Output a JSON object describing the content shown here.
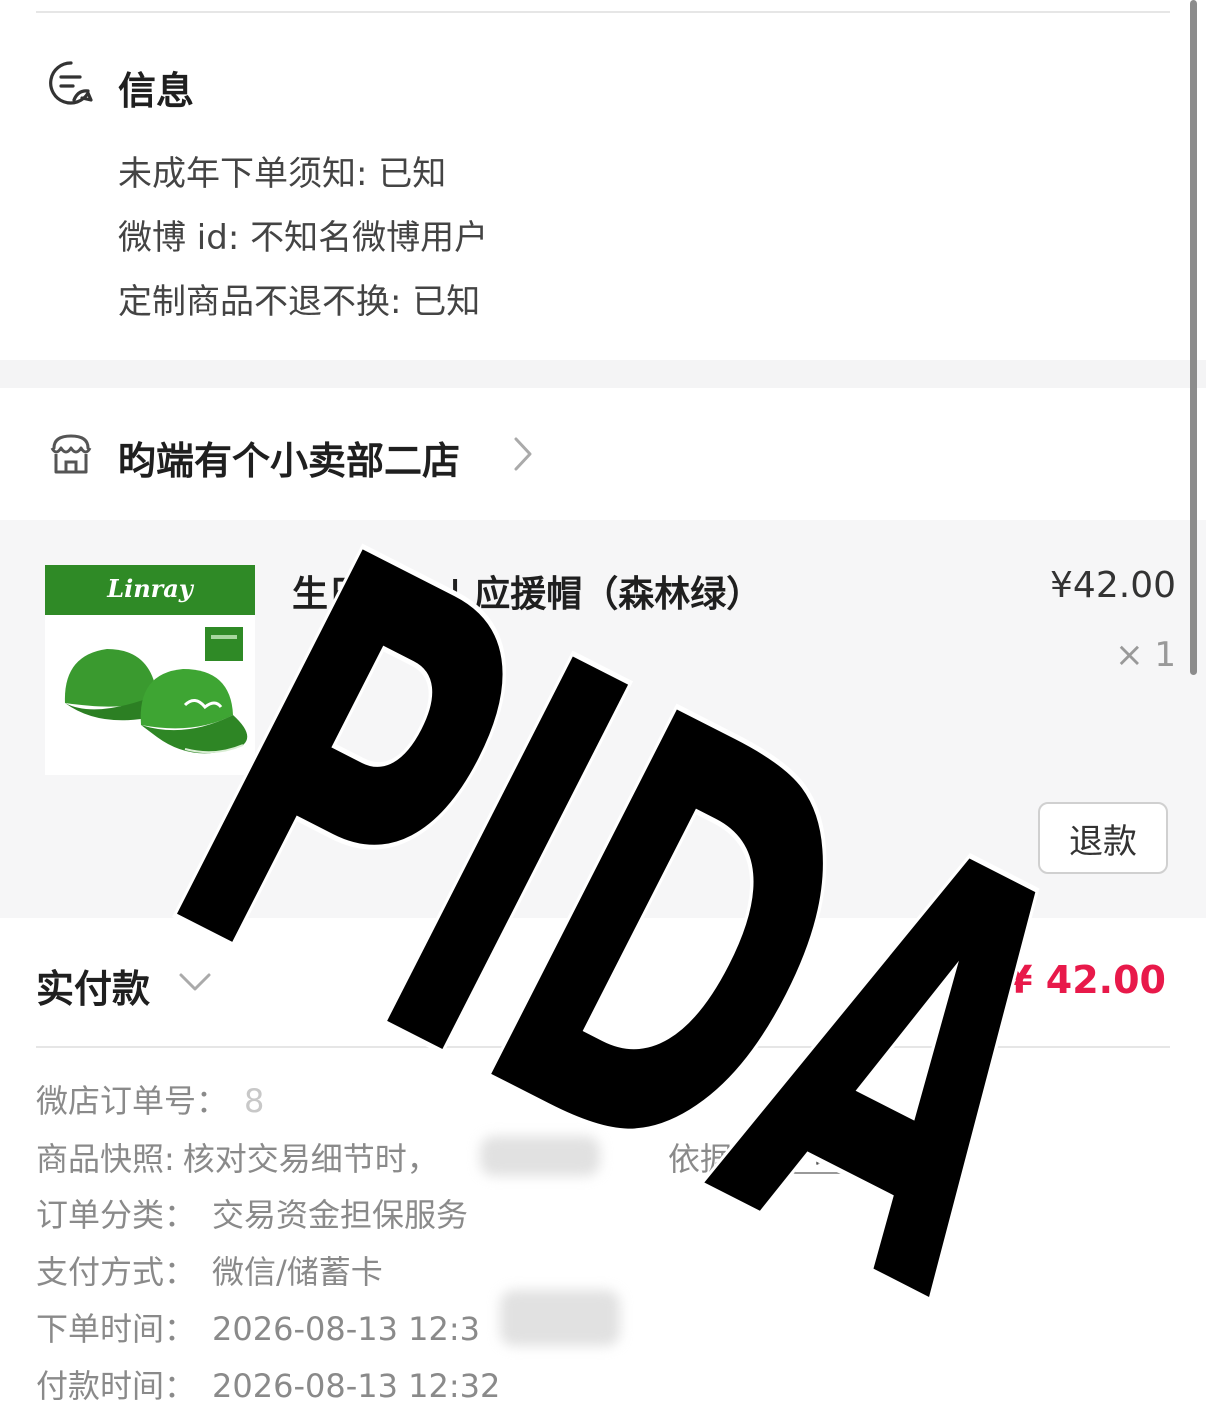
{
  "info": {
    "title": "信息",
    "lines": [
      "未成年下单须知: 已知",
      "微博 id: 不知名微博用户",
      "定制商品不退不换: 已知"
    ]
  },
  "shop": {
    "name": "昀端有个小卖部二店"
  },
  "product": {
    "thumb_brand": "Linray",
    "title": "生日周边 | 应援帽（森林绿）",
    "price": "¥42.00",
    "quantity": "× 1",
    "refund_label": "退款"
  },
  "payment": {
    "label": "实付款",
    "amount": "¥ 42.00"
  },
  "details": {
    "order_no_label": "微店订单号：",
    "order_no_value": "8",
    "snapshot_label": "商品快照:",
    "snapshot_value": "核对交易细节时，",
    "snapshot_value_tail": "依据",
    "snapshot_view": "看",
    "category_label": "订单分类：",
    "category_value": "交易资金担保服务",
    "paymethod_label": "支付方式：",
    "paymethod_value": "微信/储蓄卡",
    "order_time_label": "下单时间：",
    "order_time_value": "2026-08-13 12:3",
    "pay_time_label": "付款时间：",
    "pay_time_value": "2026-08-13 12:32"
  },
  "watermark": "PIDA",
  "colors": {
    "accent_red": "#e8194a",
    "hat_green": "#2f8a26"
  }
}
